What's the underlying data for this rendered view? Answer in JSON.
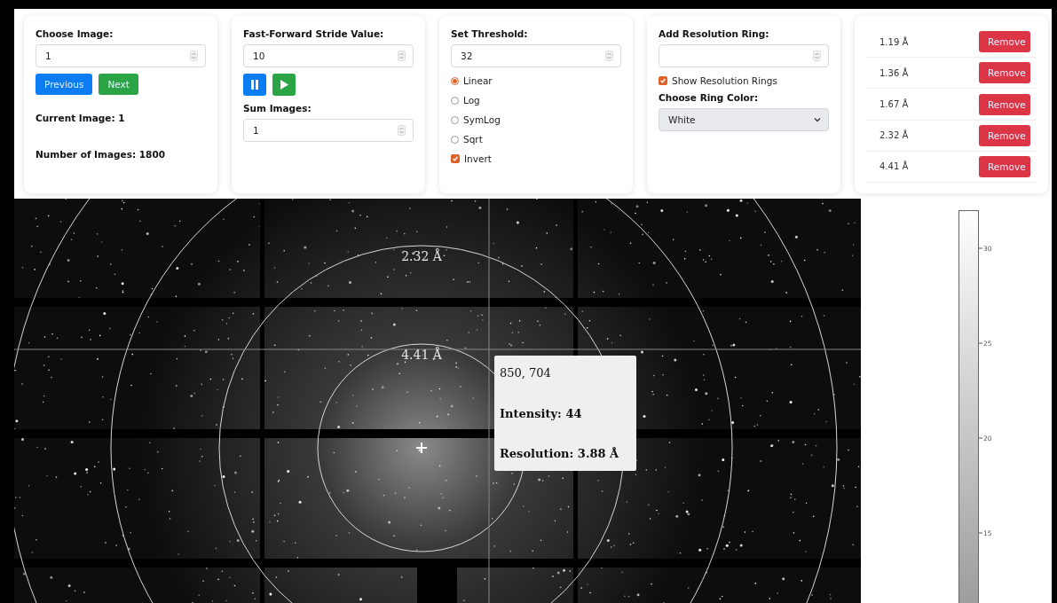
{
  "image_panel": {
    "label": "Choose Image:",
    "value": "1",
    "buttons": [
      {
        "label": "Previous",
        "kind": "primary"
      },
      {
        "label": "Next",
        "kind": "success"
      }
    ],
    "current": "Current Image: 1",
    "count": "Number of Images: 1800"
  },
  "stride_panel": {
    "label": "Fast-Forward Stride Value:",
    "value": "10",
    "controls": [
      {
        "kind": "pause"
      },
      {
        "kind": "play"
      }
    ],
    "sum_label": "Sum Images:",
    "sum_value": "1"
  },
  "threshold_panel": {
    "label": "Set Threshold:",
    "value": "32",
    "scales": [
      {
        "label": "Linear",
        "selected": true
      },
      {
        "label": "Log",
        "selected": false
      },
      {
        "label": "SymLog",
        "selected": false
      },
      {
        "label": "Sqrt",
        "selected": false
      }
    ],
    "invert": {
      "label": "Invert",
      "checked": true
    }
  },
  "ring_panel": {
    "label": "Add Resolution Ring:",
    "show_rings": {
      "label": "Show Resolution Rings",
      "checked": true
    },
    "color_label": "Choose Ring Color:",
    "color_value": "White"
  },
  "rings": [
    {
      "label": "1.19 Å",
      "button": "Remove"
    },
    {
      "label": "1.36 Å",
      "button": "Remove"
    },
    {
      "label": "1.67 Å",
      "button": "Remove"
    },
    {
      "label": "2.32 Å",
      "button": "Remove"
    },
    {
      "label": "4.41 Å",
      "button": "Remove"
    }
  ],
  "viewer": {
    "ring_labels": [
      "2.32 Å",
      "4.41 Å"
    ],
    "tooltip": {
      "coords": "850, 704",
      "intensity": "Intensity: 44",
      "resolution": "Resolution: 3.88 Å"
    }
  },
  "colorbar": {
    "ticks": [
      "30",
      "25",
      "20",
      "15"
    ]
  }
}
